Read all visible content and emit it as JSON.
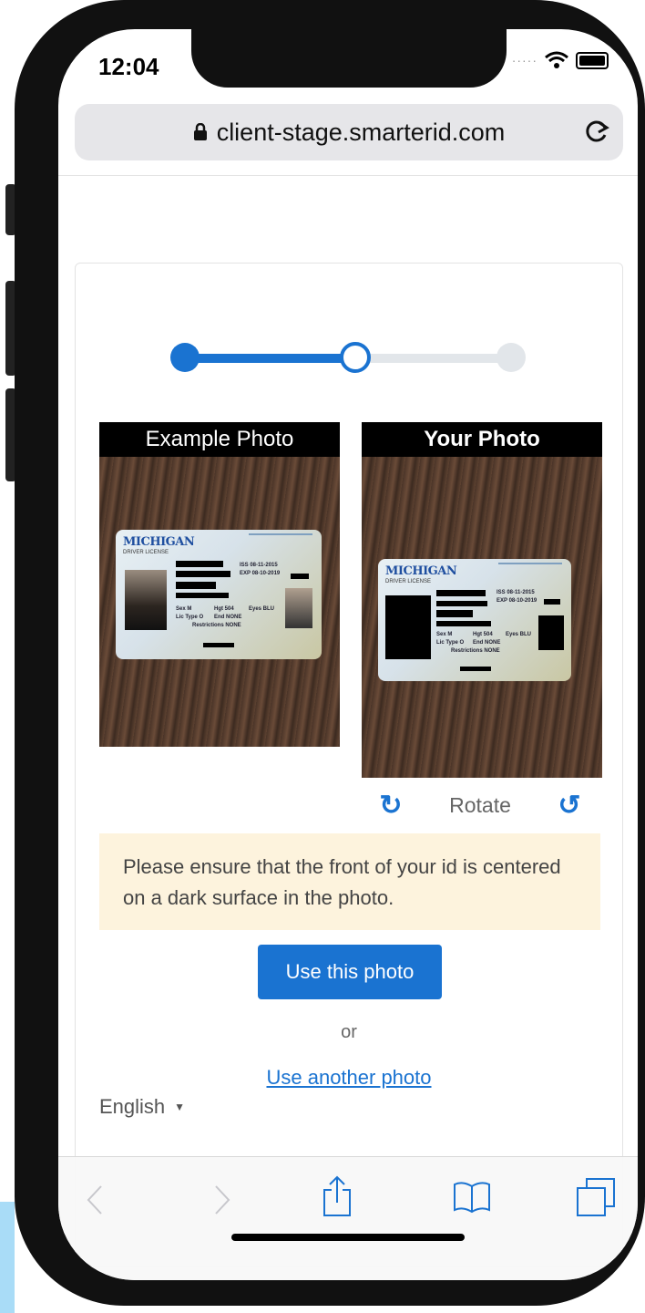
{
  "status_bar": {
    "time": "12:04"
  },
  "browser": {
    "url": "client-stage.smarterid.com"
  },
  "progress": {
    "total_steps": 3,
    "current_step": 2
  },
  "example_photo": {
    "header": "Example Photo",
    "license": {
      "state": "MICHIGAN",
      "type": "DRIVER LICENSE",
      "iss": "ISS 08-11-2015",
      "exp": "EXP 08-10-2019",
      "sex": "Sex M",
      "hgt": "Hgt 504",
      "eyes": "Eyes BLU",
      "lic_type": "Lic Type O",
      "end": "End NONE",
      "restrictions": "Restrictions NONE"
    }
  },
  "your_photo": {
    "header": "Your Photo",
    "license": {
      "state": "MICHIGAN",
      "type": "DRIVER LICENSE",
      "iss": "ISS 08-11-2015",
      "exp": "EXP 08-10-2019",
      "sex": "Sex M",
      "hgt": "Hgt 504",
      "eyes": "Eyes BLU",
      "lic_type": "Lic Type O",
      "end": "End NONE",
      "restrictions": "Restrictions NONE"
    }
  },
  "rotate": {
    "label": "Rotate",
    "clockwise_icon": "↻",
    "counterclockwise_icon": "↺"
  },
  "notice": {
    "text": "Please ensure that the front of your id is centered on a dark surface in the photo."
  },
  "actions": {
    "primary": "Use this photo",
    "separator": "or",
    "secondary": "Use another photo"
  },
  "language": {
    "selected": "English"
  },
  "colors": {
    "accent": "#1a73d1",
    "notice_bg": "#fdf3dd"
  }
}
